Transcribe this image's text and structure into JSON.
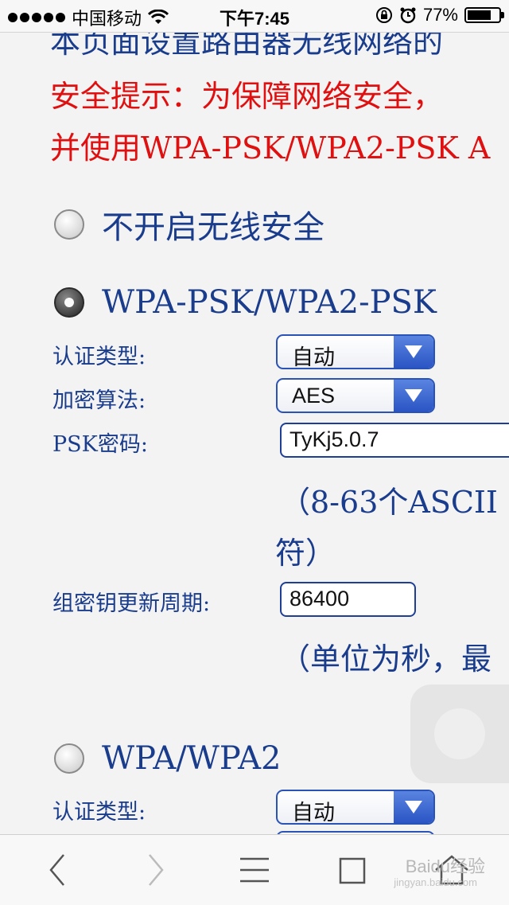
{
  "status_bar": {
    "carrier": "中国移动",
    "time": "下午7:45",
    "battery_percent": "77%",
    "battery_level": 0.77
  },
  "intro_text": "本页面设置路由器无线网络的",
  "warning": {
    "line1": "安全提示：为保障网络安全，",
    "line2": "并使用WPA-PSK/WPA2-PSK A"
  },
  "options": {
    "none": {
      "label": "不开启无线安全",
      "checked": false
    },
    "wpa_psk": {
      "label": "WPA-PSK/WPA2-PSK",
      "checked": true,
      "auth_label": "认证类型:",
      "auth_value": "自动",
      "enc_label": "加密算法:",
      "enc_value": "AES",
      "psk_label": "PSK密码:",
      "psk_value": "TyKj5.0.7",
      "psk_hint1": "（8-63个ASCII",
      "psk_hint2": "符）",
      "group_key_label": "组密钥更新周期:",
      "group_key_value": "86400",
      "group_key_hint": "（单位为秒，最"
    },
    "wpa": {
      "label": "WPA/WPA2",
      "checked": false,
      "auth_label": "认证类型:",
      "auth_value": "自动"
    }
  },
  "toolbar": {
    "icons": [
      "back-icon",
      "forward-icon",
      "menu-icon",
      "tabs-icon",
      "home-icon"
    ]
  },
  "watermark": {
    "text": "Baidu经验",
    "sub": "jingyan.baidu.com"
  }
}
